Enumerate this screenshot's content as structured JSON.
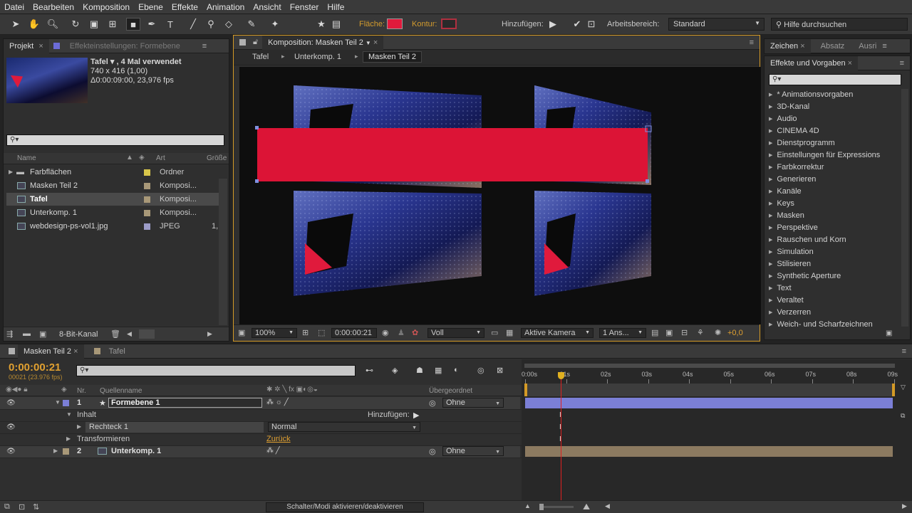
{
  "menu": [
    "Datei",
    "Bearbeiten",
    "Komposition",
    "Ebene",
    "Effekte",
    "Animation",
    "Ansicht",
    "Fenster",
    "Hilfe"
  ],
  "toolbar": {
    "fill_label": "Fläche:",
    "stroke_label": "Kontur:",
    "add_label": "Hinzufügen:",
    "workspace_label": "Arbeitsbereich:",
    "workspace_value": "Standard",
    "help_search": "Hilfe durchsuchen",
    "fill_color": "#e01a3c"
  },
  "project": {
    "tab_label": "Projekt",
    "effects_tab_label": "Effekteinstellungen: Formebene",
    "item_name": "Tafel ▾ , 4 Mal verwendet",
    "item_size": "740 x 416 (1,00)",
    "item_duration": "Δ0:00:09:00, 23,976 fps",
    "columns": {
      "name": "Name",
      "type": "Art",
      "size": "Größe"
    },
    "items": [
      {
        "name": "Farbflächen",
        "type": "Ordner",
        "size": "",
        "color": "#d8c64a"
      },
      {
        "name": "Masken Teil 2",
        "type": "Komposi...",
        "size": "",
        "color": "#a89878"
      },
      {
        "name": "Tafel",
        "type": "Komposi...",
        "size": "",
        "color": "#a89878"
      },
      {
        "name": "Unterkomp. 1",
        "type": "Komposi...",
        "size": "",
        "color": "#a89878"
      },
      {
        "name": "webdesign-ps-vol1.jpg",
        "type": "JPEG",
        "size": "1,",
        "color": "#9c9cc8"
      }
    ],
    "bit_depth": "8-Bit-Kanal"
  },
  "composition": {
    "tab_label": "Komposition: Masken Teil 2",
    "breadcrumbs": [
      "Tafel",
      "Unterkomp. 1",
      "Masken Teil 2"
    ],
    "zoom": "100%",
    "timecode": "0:00:00:21",
    "resolution": "Voll",
    "camera": "Aktive Kamera",
    "views": "1 Ans...",
    "exposure": "+0,0",
    "shape_color": "#dc1436"
  },
  "right_panel": {
    "tabs": [
      "Zeichen",
      "Absatz",
      "Ausri"
    ],
    "effects_title": "Effekte und Vorgaben",
    "effects": [
      "* Animationsvorgaben",
      "3D-Kanal",
      "Audio",
      "CINEMA 4D",
      "Dienstprogramm",
      "Einstellungen für Expressions",
      "Farbkorrektur",
      "Generieren",
      "Kanäle",
      "Keys",
      "Masken",
      "Perspektive",
      "Rauschen und Korn",
      "Simulation",
      "Stilisieren",
      "Synthetic Aperture",
      "Text",
      "Veraltet",
      "Verzerren",
      "Weich- und Scharfzeichnen"
    ]
  },
  "timeline": {
    "tabs": [
      "Masken Teil 2",
      "Tafel"
    ],
    "timecode": "0:00:00:21",
    "frame_info": "00021 (23.976 fps)",
    "columns": {
      "nr": "Nr.",
      "source": "Quellenname",
      "parent": "Übergeordnet"
    },
    "ruler": [
      "0:00s",
      "01s",
      "02s",
      "03s",
      "04s",
      "05s",
      "06s",
      "07s",
      "08s",
      "09s"
    ],
    "layers": [
      {
        "nr": "1",
        "name": "Formebene 1",
        "parent": "Ohne"
      },
      {
        "nr": "2",
        "name": "Unterkomp. 1",
        "parent": "Ohne"
      }
    ],
    "content_label": "Inhalt",
    "add_label": "Hinzufügen:",
    "rect_label": "Rechteck 1",
    "blend_mode": "Normal",
    "transform_label": "Transformieren",
    "reset_label": "Zurück",
    "toggle_label": "Schalter/Modi aktivieren/deaktivieren",
    "layer1_color": "#7b7fd6",
    "layer2_color": "#8c7a60"
  }
}
